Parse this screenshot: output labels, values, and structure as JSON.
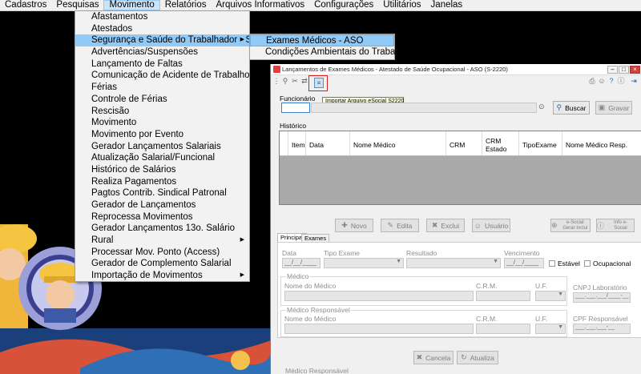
{
  "menubar": {
    "items": [
      "Cadastros",
      "Pesquisas",
      "Movimento",
      "Relatórios",
      "Arquivos Informativos",
      "Configurações",
      "Utilitários",
      "Janelas"
    ]
  },
  "movimento_menu": {
    "items": [
      {
        "label": "Afastamentos",
        "submenu": false
      },
      {
        "label": "Atestados",
        "submenu": false
      },
      {
        "label": "Segurança e Saúde do Trabalhador - SST",
        "submenu": true,
        "highlighted": true
      },
      {
        "label": "Advertências/Suspensões",
        "submenu": false
      },
      {
        "label": "Lançamento de Faltas",
        "submenu": false
      },
      {
        "label": "Comunicação de Acidente de Trabalho (CAT)",
        "submenu": false
      },
      {
        "label": "Férias",
        "submenu": false
      },
      {
        "label": "Controle de Férias",
        "submenu": false
      },
      {
        "label": "Rescisão",
        "submenu": false
      },
      {
        "label": "Movimento",
        "submenu": false
      },
      {
        "label": "Movimento por Evento",
        "submenu": false
      },
      {
        "label": "Gerador Lançamentos Salariais",
        "submenu": false
      },
      {
        "label": "Atualização Salarial/Funcional",
        "submenu": false
      },
      {
        "label": "Histórico de Salários",
        "submenu": false
      },
      {
        "label": "Realiza Pagamentos",
        "submenu": false
      },
      {
        "label": "Pagtos Contrib. Sindical Patronal",
        "submenu": false
      },
      {
        "label": "Gerador de Lançamentos",
        "submenu": false
      },
      {
        "label": "Reprocessa Movimentos",
        "submenu": false
      },
      {
        "label": "Gerador Lançamentos 13o. Salário",
        "submenu": false
      },
      {
        "label": "Rural",
        "submenu": true
      },
      {
        "label": "Processar Mov. Ponto (Access)",
        "submenu": false
      },
      {
        "label": "Gerador de Complemento Salarial",
        "submenu": false
      },
      {
        "label": "Importação de Movimentos",
        "submenu": true
      }
    ]
  },
  "sst_submenu": {
    "items": [
      {
        "label": "Exames Médicos - ASO",
        "highlighted": true
      },
      {
        "label": "Condições Ambientais do Trabalho",
        "highlighted": false
      }
    ]
  },
  "window": {
    "title": "Lançamentos de Exames Médicos - Atestado de Saúde Ocupacional - ASO (S-2220)",
    "tooltip": "Importar Arquivo eSocial S2220",
    "funcionario_label": "Funcionário",
    "buscar_label": "Buscar",
    "gravar_label": "Gravar",
    "historico_label": "Histórico",
    "grid_columns": [
      "Item",
      "Data",
      "Nome Médico",
      "CRM",
      "CRM Estado",
      "TipoExame",
      "Nome Médico Resp."
    ],
    "action_buttons": [
      "Novo",
      "Edita",
      "Exclui",
      "Usuário"
    ],
    "esocial_gerar": "e-Social Gerar Inclui",
    "info_esocial": "Info e-Social",
    "tabs": [
      "Principal",
      "Exames"
    ],
    "form": {
      "data_label": "Data",
      "data_value": "__/__/____",
      "tipo_exame_label": "Tipo Exame",
      "resultado_label": "Resultado",
      "vencimento_label": "Vencimento",
      "vencimento_value": "__/__/____",
      "estavel_label": "Estável",
      "ocupacional_label": "Ocupacional",
      "medico_group": "Médico",
      "nome_medico_label": "Nome do Médico",
      "crm_label": "C.R.M.",
      "uf_label": "U.F.",
      "cnpj_label": "CNPJ Laboratório",
      "cnpj_value": "___.___.___/____-__",
      "medico_resp_group": "Médico Responsável",
      "nome_medico_resp_label": "Nome do Médico",
      "crm_resp_label": "C.R.M.",
      "uf_resp_label": "U.F.",
      "cpf_label": "CPF Responsável",
      "cpf_value": "___.___.___-__"
    },
    "cancela_label": "Cancela",
    "atualiza_label": "Atualiza",
    "medico_resp_bottom": "Médico Responsável"
  }
}
